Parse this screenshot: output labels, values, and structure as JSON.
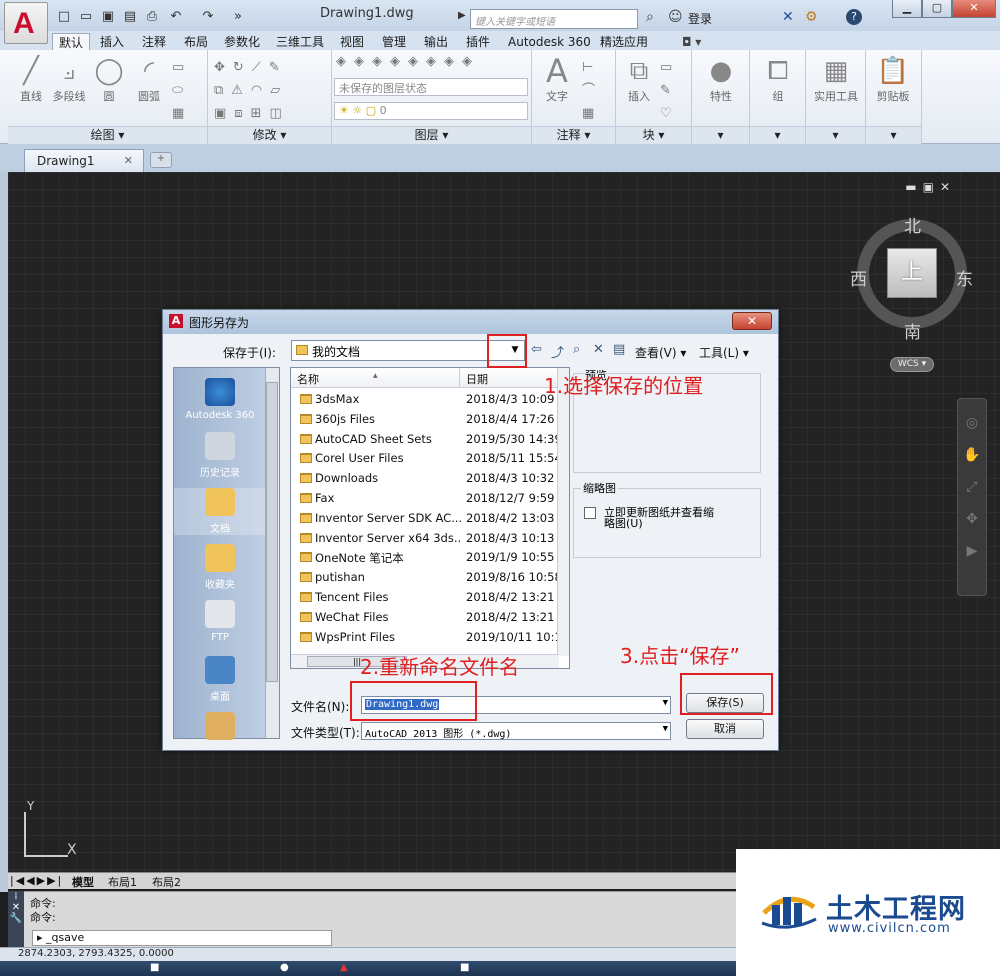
{
  "title_bar": {
    "doc_title": "Drawing1.dwg",
    "search_placeholder": "键入关键字或短语",
    "login_label": "登录",
    "help_label": "?",
    "minimize": "▁",
    "restore": "▢",
    "close": "✕"
  },
  "ribbon_tabs": [
    "默认",
    "插入",
    "注释",
    "布局",
    "参数化",
    "三维工具",
    "视图",
    "管理",
    "输出",
    "插件",
    "Autodesk 360",
    "精选应用"
  ],
  "ribbon": {
    "draw_tools": [
      "直线",
      "多段线",
      "圆",
      "圆弧"
    ],
    "draw_title": "绘图 ▾",
    "modify_title": "修改 ▾",
    "layer_state": "未保存的图层状态",
    "layer_current": "0",
    "layer_title": "图层 ▾",
    "text_tool": "文字",
    "annotate_title": "注释 ▾",
    "insert_tool": "插入",
    "block_title": "块 ▾",
    "props_tool": "特性",
    "group_tool": "组",
    "util_tool": "实用工具",
    "clip_tool": "剪贴板",
    "collapse": "▾"
  },
  "file_tabs": {
    "current": "Drawing1",
    "close": "✕",
    "new": "+"
  },
  "viewcube": {
    "north": "北",
    "south": "南",
    "east": "东",
    "west": "西",
    "face": "上",
    "wcs": "WCS ▾"
  },
  "ucs": {
    "x": "X",
    "y": "Y"
  },
  "layout_tabs": [
    "模型",
    "布局1",
    "布局2"
  ],
  "command": {
    "line1": "命令:",
    "line2": "命令:",
    "input": "_qsave",
    "prompt_glyph": "▸"
  },
  "statusbar": {
    "coords": "2874.2303, 2793.4325, 0.0000"
  },
  "watermark": {
    "name": "土木工程网",
    "url": "www.civilcn.com"
  },
  "dialog": {
    "title": "图形另存为",
    "close": "✕",
    "save_in_label": "保存于(I):",
    "save_in_value": "我的文档",
    "view_label": "查看(V)",
    "tools_label": "工具(L)",
    "places": [
      "Autodesk 360",
      "历史记录",
      "文档",
      "收藏夹",
      "FTP",
      "桌面"
    ],
    "columns": {
      "name": "名称",
      "date": "日期"
    },
    "files": [
      {
        "name": "3dsMax",
        "date": "2018/4/3 10:09"
      },
      {
        "name": "360js Files",
        "date": "2018/4/4 17:26"
      },
      {
        "name": "AutoCAD Sheet Sets",
        "date": "2019/5/30 14:39"
      },
      {
        "name": "Corel User Files",
        "date": "2018/5/11 15:54"
      },
      {
        "name": "Downloads",
        "date": "2018/4/3 10:32"
      },
      {
        "name": "Fax",
        "date": "2018/12/7 9:59"
      },
      {
        "name": "Inventor Server SDK AC...",
        "date": "2018/4/2 13:03"
      },
      {
        "name": "Inventor Server x64 3ds...",
        "date": "2018/4/3 10:13"
      },
      {
        "name": "OneNote 笔记本",
        "date": "2019/1/9 10:55"
      },
      {
        "name": "putishan",
        "date": "2019/8/16 10:58"
      },
      {
        "name": "Tencent Files",
        "date": "2018/4/2 13:21"
      },
      {
        "name": "WeChat Files",
        "date": "2018/4/2 13:21"
      },
      {
        "name": "WpsPrint Files",
        "date": "2019/10/11 10:1"
      }
    ],
    "preview_label": "预览",
    "thumb_label": "缩略图",
    "thumb_check_label": "立即更新图纸并查看缩略图(U)",
    "filename_label": "文件名(N):",
    "filename_value": "Drawing1.dwg",
    "filetype_label": "文件类型(T):",
    "filetype_value": "AutoCAD 2013 图形 (*.dwg)",
    "save_button": "保存(S)",
    "cancel_button": "取消"
  },
  "annotations": {
    "step1": "1.选择保存的位置",
    "step2": "2.重新命名文件名",
    "step3": "3.点击“保存”",
    "color": "#e02020"
  }
}
